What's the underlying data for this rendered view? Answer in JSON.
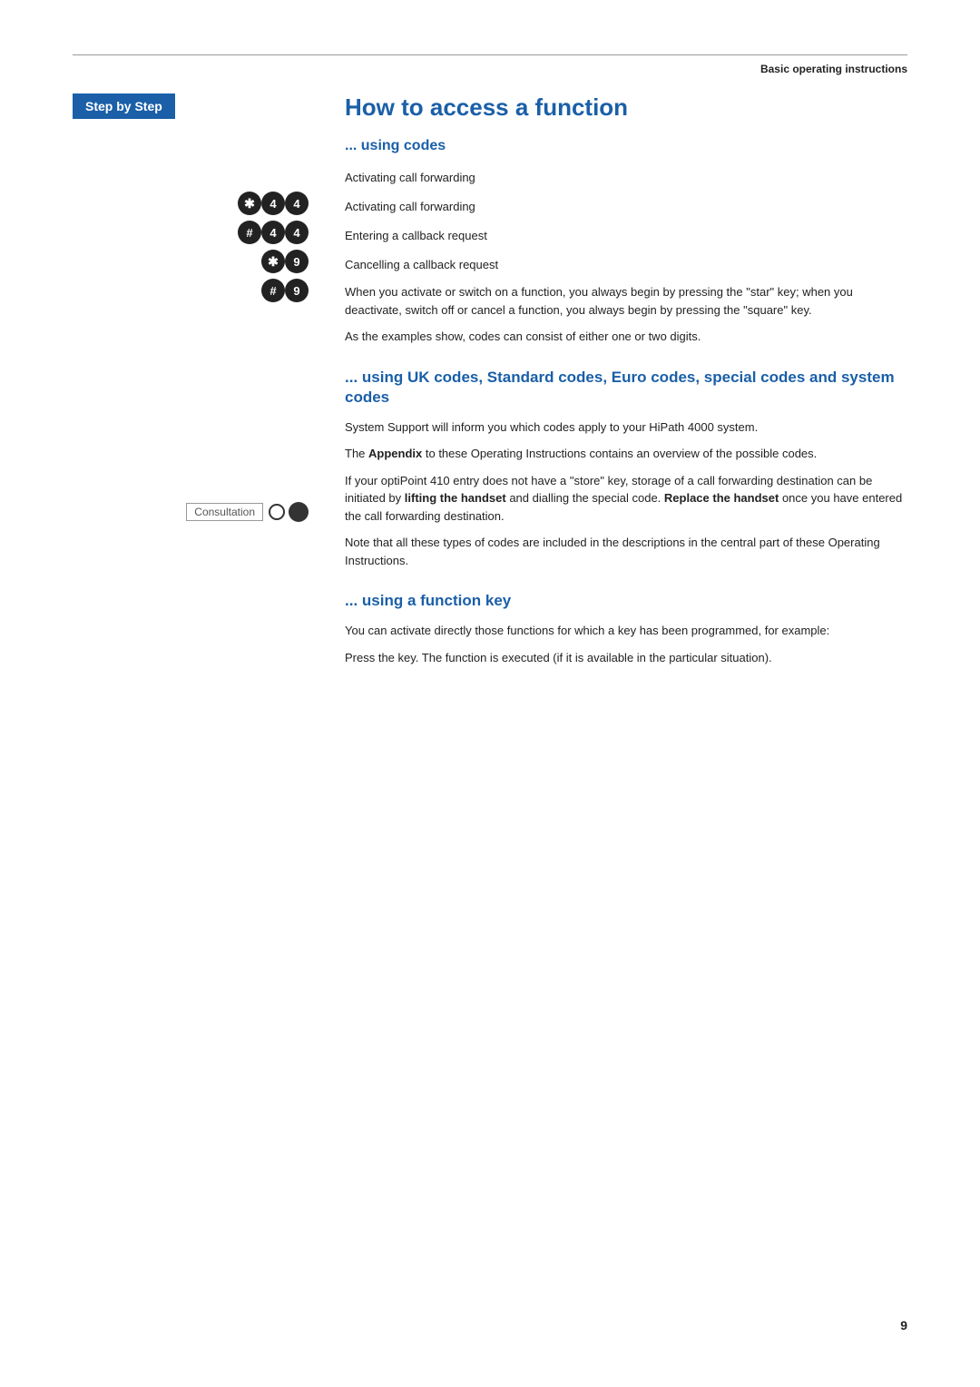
{
  "header": {
    "section_title": "Basic operating instructions"
  },
  "sidebar": {
    "step_by_step_label": "Step by Step"
  },
  "page": {
    "title": "How to access a function",
    "using_codes_heading": "... using codes",
    "code_rows": [
      {
        "icons": [
          "star",
          "4",
          "4"
        ],
        "description": "Activating call forwarding"
      },
      {
        "icons": [
          "hash",
          "4",
          "4"
        ],
        "description": "Activating call forwarding"
      },
      {
        "icons": [
          "star",
          "9"
        ],
        "description": "Entering a callback request"
      },
      {
        "icons": [
          "hash",
          "9"
        ],
        "description": "Cancelling a callback request"
      }
    ],
    "para1": "When you activate or switch on a function, you always begin by pressing the \"star\" key; when you deactivate, switch off or cancel a function, you always begin by pressing the \"square\" key.",
    "para2": "As the examples show, codes can consist of either one or two digits.",
    "uk_codes_heading": "... using UK codes, Standard codes, Euro codes, special codes and system codes",
    "para3": "System Support will inform you which codes apply to your HiPath 4000 system.",
    "para4_pre": "The ",
    "para4_bold": "Appendix",
    "para4_post": " to these Operating Instructions contains an overview of the possible codes.",
    "para5_pre": "If your optiPoint 410 entry does not have a \"store\" key, storage of a call forwarding destination can be initiated by ",
    "para5_bold1": "lifting the handset",
    "para5_mid": " and dialling the special code. ",
    "para5_bold2": "Replace the handset",
    "para5_post": " once you have entered the call forwarding destination.",
    "para6": "Note that all these types of codes are included in the descriptions in the central part of these Operating Instructions.",
    "function_key_heading": "... using a function key",
    "para7": "You can activate directly those functions for which a key has been programmed, for example:",
    "consultation_label": "Consultation",
    "consultation_desc": "Press the key. The function is executed (if it is available in the particular situation).",
    "page_number": "9"
  }
}
